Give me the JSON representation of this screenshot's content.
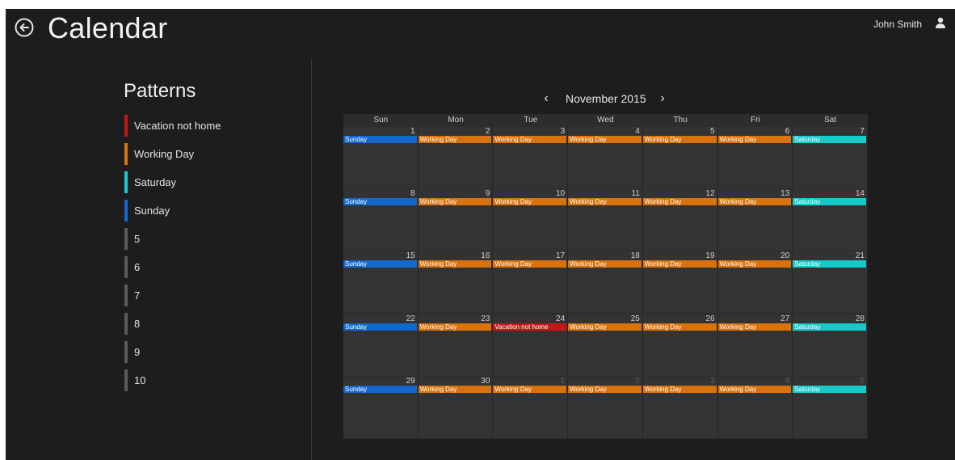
{
  "header": {
    "title": "Calendar",
    "user_name": "John Smith"
  },
  "icons": {
    "back": "back-arrow-circle-icon",
    "user": "user-icon",
    "prev": "chevron-left-icon",
    "next": "chevron-right-icon"
  },
  "patterns": {
    "title": "Patterns",
    "items": [
      {
        "label": "Vacation not home",
        "color": "#c41818"
      },
      {
        "label": "Working Day",
        "color": "#d9720c"
      },
      {
        "label": "Saturday",
        "color": "#18c9c9"
      },
      {
        "label": "Sunday",
        "color": "#1268cc"
      },
      {
        "label": "5",
        "color": "#5a5a5a"
      },
      {
        "label": "6",
        "color": "#5a5a5a"
      },
      {
        "label": "7",
        "color": "#5a5a5a"
      },
      {
        "label": "8",
        "color": "#5a5a5a"
      },
      {
        "label": "9",
        "color": "#5a5a5a"
      },
      {
        "label": "10",
        "color": "#5a5a5a"
      }
    ]
  },
  "calendar": {
    "month_label": "November 2015",
    "prev_symbol": "‹",
    "next_symbol": "›",
    "weekdays": [
      "Sun",
      "Mon",
      "Tue",
      "Wed",
      "Thu",
      "Fri",
      "Sat"
    ],
    "event_colors": {
      "Sunday": "#1268cc",
      "Working Day": "#d9720c",
      "Saturday": "#18c9c9",
      "Vacation not home": "#c41818"
    },
    "weeks": [
      [
        {
          "day": "1",
          "event": "Sunday",
          "current": true
        },
        {
          "day": "2",
          "event": "Working Day",
          "current": true
        },
        {
          "day": "3",
          "event": "Working Day",
          "current": true
        },
        {
          "day": "4",
          "event": "Working Day",
          "current": true
        },
        {
          "day": "5",
          "event": "Working Day",
          "current": true
        },
        {
          "day": "6",
          "event": "Working Day",
          "current": true
        },
        {
          "day": "7",
          "event": "Saturday",
          "current": true
        }
      ],
      [
        {
          "day": "8",
          "event": "Sunday",
          "current": true
        },
        {
          "day": "9",
          "event": "Working Day",
          "current": true
        },
        {
          "day": "10",
          "event": "Working Day",
          "current": true
        },
        {
          "day": "11",
          "event": "Working Day",
          "current": true
        },
        {
          "day": "12",
          "event": "Working Day",
          "current": true
        },
        {
          "day": "13",
          "event": "Working Day",
          "current": true
        },
        {
          "day": "14",
          "event": "Saturday",
          "current": true
        }
      ],
      [
        {
          "day": "15",
          "event": "Sunday",
          "current": true
        },
        {
          "day": "16",
          "event": "Working Day",
          "current": true
        },
        {
          "day": "17",
          "event": "Working Day",
          "current": true
        },
        {
          "day": "18",
          "event": "Working Day",
          "current": true
        },
        {
          "day": "19",
          "event": "Working Day",
          "current": true
        },
        {
          "day": "20",
          "event": "Working Day",
          "current": true
        },
        {
          "day": "21",
          "event": "Saturday",
          "current": true
        }
      ],
      [
        {
          "day": "22",
          "event": "Sunday",
          "current": true
        },
        {
          "day": "23",
          "event": "Working Day",
          "current": true
        },
        {
          "day": "24",
          "event": "Vacation not home",
          "current": true
        },
        {
          "day": "25",
          "event": "Working Day",
          "current": true
        },
        {
          "day": "26",
          "event": "Working Day",
          "current": true
        },
        {
          "day": "27",
          "event": "Working Day",
          "current": true
        },
        {
          "day": "28",
          "event": "Saturday",
          "current": true
        }
      ],
      [
        {
          "day": "29",
          "event": "Sunday",
          "current": true
        },
        {
          "day": "30",
          "event": "Working Day",
          "current": true
        },
        {
          "day": "1",
          "event": "Working Day",
          "current": false
        },
        {
          "day": "2",
          "event": "Working Day",
          "current": false
        },
        {
          "day": "3",
          "event": "Working Day",
          "current": false
        },
        {
          "day": "4",
          "event": "Working Day",
          "current": false
        },
        {
          "day": "5",
          "event": "Saturday",
          "current": false
        }
      ]
    ]
  }
}
